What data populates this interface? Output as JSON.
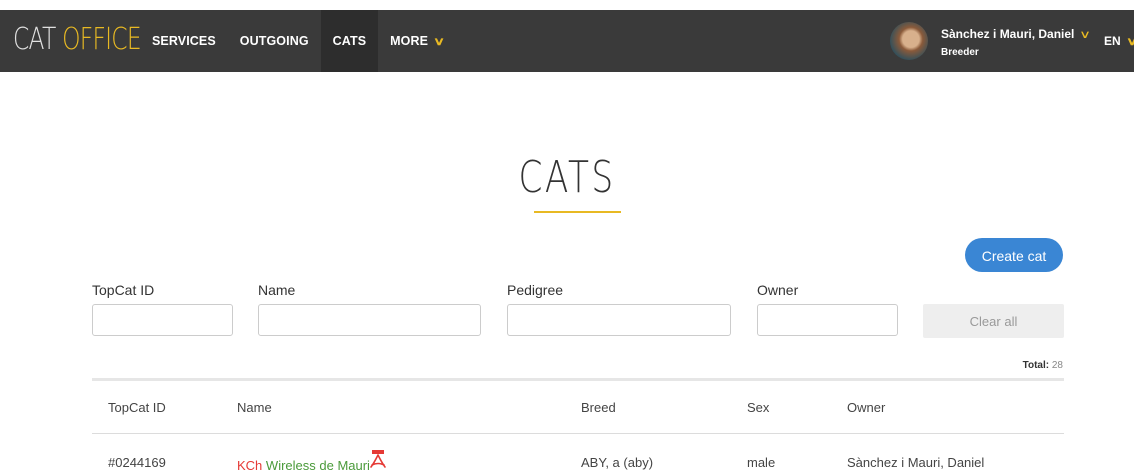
{
  "header": {
    "logo_part1": "CAT ",
    "logo_part2": "OFFICE",
    "nav": [
      {
        "label": "SERVICES"
      },
      {
        "label": "OUTGOING"
      },
      {
        "label": "CATS"
      },
      {
        "label": "MORE"
      }
    ],
    "user": {
      "name": "Sànchez i Mauri, Daniel",
      "role": "Breeder"
    },
    "language": "EN"
  },
  "page": {
    "title": "CATS",
    "create_label": "Create cat"
  },
  "filters": {
    "topcat_id_label": "TopCat ID",
    "name_label": "Name",
    "pedigree_label": "Pedigree",
    "owner_label": "Owner",
    "clear_label": "Clear all",
    "total_label": "Total:",
    "total_value": "28"
  },
  "table": {
    "columns": [
      "TopCat ID",
      "Name",
      "Breed",
      "Sex",
      "Owner"
    ],
    "rows": [
      {
        "id": "#0244169",
        "title": "KCh",
        "name": "Wireless de Mauri",
        "breed": "ABY, a (aby)",
        "sex": "male",
        "owner": "Sànchez i Mauri, Daniel"
      }
    ]
  },
  "colors": {
    "topbar": "#3a3a3a",
    "accent": "#e8b923",
    "primary_button": "#3a86d4"
  },
  "icons": {
    "more_chevron": "chevron-down-icon",
    "pdf": "pdf-icon"
  }
}
